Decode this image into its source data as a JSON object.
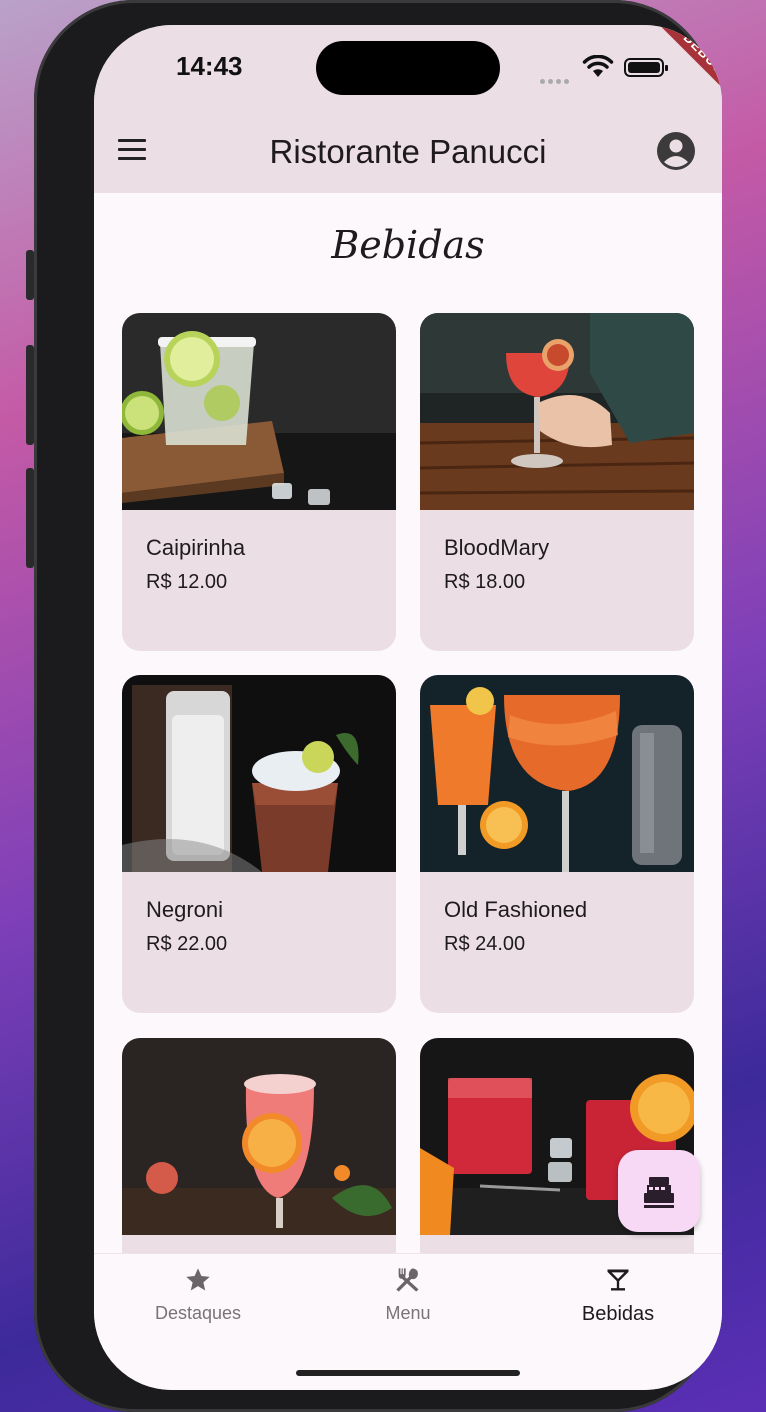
{
  "status_bar": {
    "time": "14:43",
    "debug_banner": "DEBUG"
  },
  "app_bar": {
    "title": "Ristorante Panucci",
    "menu_icon": "hamburger-menu-icon",
    "account_icon": "account-circle-icon"
  },
  "page": {
    "title": "Bebidas"
  },
  "drinks": [
    {
      "name": "Caipirinha",
      "price": "R$ 12.00"
    },
    {
      "name": "BloodMary",
      "price": "R$ 18.00"
    },
    {
      "name": "Negroni",
      "price": "R$ 22.00"
    },
    {
      "name": "Old Fashioned",
      "price": "R$ 24.00"
    },
    {
      "name": "",
      "price": ""
    },
    {
      "name": "",
      "price": ""
    }
  ],
  "fab": {
    "icon": "cash-register-icon"
  },
  "bottom_nav": [
    {
      "label": "Destaques",
      "icon": "star-icon",
      "active": false
    },
    {
      "label": "Menu",
      "icon": "fork-spoon-icon",
      "active": false
    },
    {
      "label": "Bebidas",
      "icon": "cocktail-glass-icon",
      "active": true
    }
  ],
  "colors": {
    "app_bar": "#ebdfe5",
    "card": "#ebdfe5",
    "fab": "#f8d9f5",
    "background": "#fcf8fb"
  }
}
